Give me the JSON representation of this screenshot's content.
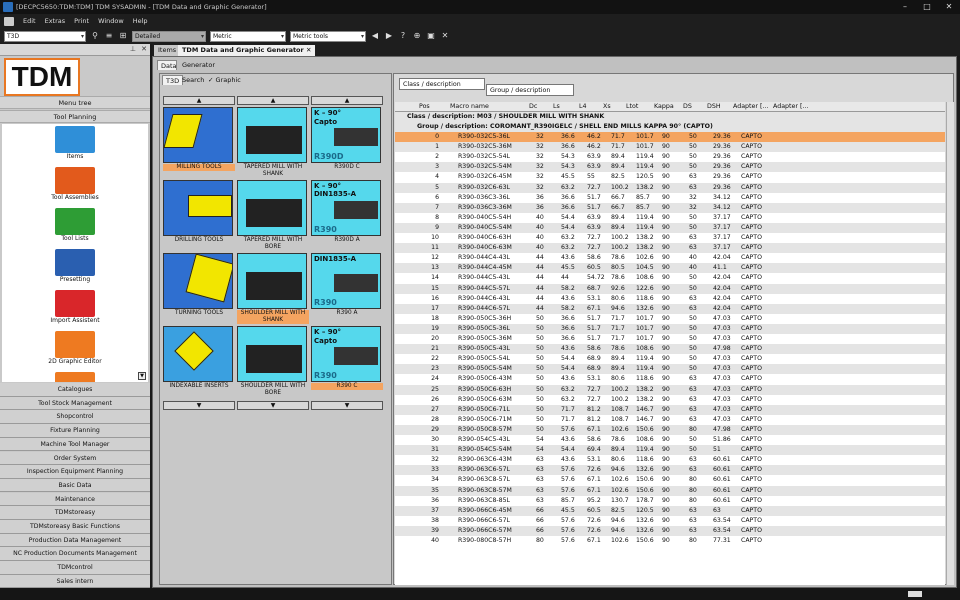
{
  "window": {
    "title": "[DECPC5650:TDM:TDM] TDM SYSADMIN - [TDM Data and Graphic Generator]"
  },
  "menu": [
    "Edit",
    "Extras",
    "Print",
    "Window",
    "Help"
  ],
  "toolbar": {
    "module_combo": "T3D",
    "view_combo": "Detailed",
    "unit_combo": "Metric",
    "unit_tools_combo": "Metric tools"
  },
  "left": {
    "logo": "TDM",
    "menu_tree": "Menu tree",
    "tool_planning": "Tool Planning",
    "items": [
      {
        "label": "Items",
        "color": "#2f8fd8"
      },
      {
        "label": "Tool Assemblies",
        "color": "#e25a1c"
      },
      {
        "label": "Tool Lists",
        "color": "#2e9d35"
      },
      {
        "label": "Presetting",
        "color": "#2a5fb0"
      },
      {
        "label": "Import Assistent",
        "color": "#d9262a"
      },
      {
        "label": "2D Graphic Editor",
        "color": "#ee7a21"
      },
      {
        "label": "",
        "color": "#ee7a21"
      }
    ],
    "nav": [
      "Catalogues",
      "Tool Stock Management",
      "Shopcontrol",
      "Fixture Planning",
      "Machine Tool Manager",
      "Order System",
      "Inspection Equipment Planning",
      "Basic Data",
      "Maintenance",
      "TDMstoreasy",
      "TDMstoreasy Basic Functions",
      "Production Data Management",
      "NC Production Documents Management",
      "TDMcontrol",
      "Sales intern"
    ]
  },
  "doctabs": [
    "Items",
    "TDM Data and Graphic Generator"
  ],
  "subtabs": [
    "Data",
    "Generator"
  ],
  "gallery": {
    "tabs": [
      "T3D",
      "Search",
      "Graphic"
    ],
    "graphic_checked": "✓",
    "up": "▲",
    "down": "▼",
    "cells": [
      {
        "label": "MILLING TOOLS",
        "selected": true,
        "kind": "mill"
      },
      {
        "label": "TAPERED MILL WITH SHANK",
        "selected": false,
        "kind": "taper"
      },
      {
        "label": "R390D C",
        "selected": false,
        "kind": "capto"
      },
      {
        "label": "DRILLING TOOLS",
        "selected": false,
        "kind": "drill"
      },
      {
        "label": "TAPERED MILL WITH BORE",
        "selected": false,
        "kind": "taper"
      },
      {
        "label": "R390D A",
        "selected": false,
        "kind": "din"
      },
      {
        "label": "TURNING TOOLS",
        "selected": false,
        "kind": "turn"
      },
      {
        "label": "SHOULDER MILL WITH SHANK",
        "selected": true,
        "kind": "taper"
      },
      {
        "label": "R390 A",
        "selected": false,
        "kind": "din2"
      },
      {
        "label": "INDEXABLE INSERTS",
        "selected": false,
        "kind": "insert"
      },
      {
        "label": "SHOULDER MILL WITH BORE",
        "selected": false,
        "kind": "taper"
      },
      {
        "label": "R390 C",
        "selected": true,
        "kind": "capto2"
      }
    ],
    "img_text": {
      "k90": "K – 90°",
      "capto": "Capto",
      "din": "DIN1835-A",
      "r390d": "R390D",
      "r390": "R390"
    }
  },
  "table": {
    "group_field1": "Class / description",
    "group_field2": "Group / description",
    "columns": [
      "Pos",
      "Macro name",
      "Dc",
      "Ls",
      "L4",
      "Xs",
      "Ltot",
      "Kappa",
      "DS",
      "DSH",
      "Adapter [...",
      "Adapter [..."
    ],
    "class_row": "Class / description: M03  /  SHOULDER MILL WITH SHANK",
    "group_row": "Group / description: COROMANT_R390IGELC  /  SHELL END MILLS KAPPA 90° (CAPTO)",
    "rows": [
      [
        "0",
        "R390-032C5-36L",
        "32",
        "36.6",
        "46.2",
        "71.7",
        "101.7",
        "90",
        "50",
        "29.36",
        "CAPTO"
      ],
      [
        "1",
        "R390-032C5-36M",
        "32",
        "36.6",
        "46.2",
        "71.7",
        "101.7",
        "90",
        "50",
        "29.36",
        "CAPTO"
      ],
      [
        "2",
        "R390-032C5-54L",
        "32",
        "54.3",
        "63.9",
        "89.4",
        "119.4",
        "90",
        "50",
        "29.36",
        "CAPTO"
      ],
      [
        "3",
        "R390-032C5-54M",
        "32",
        "54.3",
        "63.9",
        "89.4",
        "119.4",
        "90",
        "50",
        "29.36",
        "CAPTO"
      ],
      [
        "4",
        "R390-032C6-45M",
        "32",
        "45.5",
        "55",
        "82.5",
        "120.5",
        "90",
        "63",
        "29.36",
        "CAPTO"
      ],
      [
        "5",
        "R390-032C6-63L",
        "32",
        "63.2",
        "72.7",
        "100.2",
        "138.2",
        "90",
        "63",
        "29.36",
        "CAPTO"
      ],
      [
        "6",
        "R390-036C3-36L",
        "36",
        "36.6",
        "51.7",
        "66.7",
        "85.7",
        "90",
        "32",
        "34.12",
        "CAPTO"
      ],
      [
        "7",
        "R390-036C3-36M",
        "36",
        "36.6",
        "51.7",
        "66.7",
        "85.7",
        "90",
        "32",
        "34.12",
        "CAPTO"
      ],
      [
        "8",
        "R390-040C5-54H",
        "40",
        "54.4",
        "63.9",
        "89.4",
        "119.4",
        "90",
        "50",
        "37.17",
        "CAPTO"
      ],
      [
        "9",
        "R390-040C5-54M",
        "40",
        "54.4",
        "63.9",
        "89.4",
        "119.4",
        "90",
        "50",
        "37.17",
        "CAPTO"
      ],
      [
        "10",
        "R390-040C6-63H",
        "40",
        "63.2",
        "72.7",
        "100.2",
        "138.2",
        "90",
        "63",
        "37.17",
        "CAPTO"
      ],
      [
        "11",
        "R390-040C6-63M",
        "40",
        "63.2",
        "72.7",
        "100.2",
        "138.2",
        "90",
        "63",
        "37.17",
        "CAPTO"
      ],
      [
        "12",
        "R390-044C4-43L",
        "44",
        "43.6",
        "58.6",
        "78.6",
        "102.6",
        "90",
        "40",
        "42.04",
        "CAPTO"
      ],
      [
        "13",
        "R390-044C4-45M",
        "44",
        "45.5",
        "60.5",
        "80.5",
        "104.5",
        "90",
        "40",
        "41.1",
        "CAPTO"
      ],
      [
        "14",
        "R390-044C5-43L",
        "44",
        "44",
        "54.72",
        "78.6",
        "108.6",
        "90",
        "50",
        "42.04",
        "CAPTO"
      ],
      [
        "15",
        "R390-044C5-57L",
        "44",
        "58.2",
        "68.7",
        "92.6",
        "122.6",
        "90",
        "50",
        "42.04",
        "CAPTO"
      ],
      [
        "16",
        "R390-044C6-43L",
        "44",
        "43.6",
        "53.1",
        "80.6",
        "118.6",
        "90",
        "63",
        "42.04",
        "CAPTO"
      ],
      [
        "17",
        "R390-044C6-57L",
        "44",
        "58.2",
        "67.1",
        "94.6",
        "132.6",
        "90",
        "63",
        "42.04",
        "CAPTO"
      ],
      [
        "18",
        "R390-050C5-36H",
        "50",
        "36.6",
        "51.7",
        "71.7",
        "101.7",
        "90",
        "50",
        "47.03",
        "CAPTO"
      ],
      [
        "19",
        "R390-050C5-36L",
        "50",
        "36.6",
        "51.7",
        "71.7",
        "101.7",
        "90",
        "50",
        "47.03",
        "CAPTO"
      ],
      [
        "20",
        "R390-050C5-36M",
        "50",
        "36.6",
        "51.7",
        "71.7",
        "101.7",
        "90",
        "50",
        "47.03",
        "CAPTO"
      ],
      [
        "21",
        "R390-050C5-43L",
        "50",
        "43.6",
        "58.6",
        "78.6",
        "108.6",
        "90",
        "50",
        "47.98",
        "CAPTO"
      ],
      [
        "22",
        "R390-050C5-54L",
        "50",
        "54.4",
        "68.9",
        "89.4",
        "119.4",
        "90",
        "50",
        "47.03",
        "CAPTO"
      ],
      [
        "23",
        "R390-050C5-54M",
        "50",
        "54.4",
        "68.9",
        "89.4",
        "119.4",
        "90",
        "50",
        "47.03",
        "CAPTO"
      ],
      [
        "24",
        "R390-050C6-43M",
        "50",
        "43.6",
        "53.1",
        "80.6",
        "118.6",
        "90",
        "63",
        "47.03",
        "CAPTO"
      ],
      [
        "25",
        "R390-050C6-63H",
        "50",
        "63.2",
        "72.7",
        "100.2",
        "138.2",
        "90",
        "63",
        "47.03",
        "CAPTO"
      ],
      [
        "26",
        "R390-050C6-63M",
        "50",
        "63.2",
        "72.7",
        "100.2",
        "138.2",
        "90",
        "63",
        "47.03",
        "CAPTO"
      ],
      [
        "27",
        "R390-050C6-71L",
        "50",
        "71.7",
        "81.2",
        "108.7",
        "146.7",
        "90",
        "63",
        "47.03",
        "CAPTO"
      ],
      [
        "28",
        "R390-050C6-71M",
        "50",
        "71.7",
        "81.2",
        "108.7",
        "146.7",
        "90",
        "63",
        "47.03",
        "CAPTO"
      ],
      [
        "29",
        "R390-050C8-57M",
        "50",
        "57.6",
        "67.1",
        "102.6",
        "150.6",
        "90",
        "80",
        "47.98",
        "CAPTO"
      ],
      [
        "30",
        "R390-054C5-43L",
        "54",
        "43.6",
        "58.6",
        "78.6",
        "108.6",
        "90",
        "50",
        "51.86",
        "CAPTO"
      ],
      [
        "31",
        "R390-054C5-54M",
        "54",
        "54.4",
        "69.4",
        "89.4",
        "119.4",
        "90",
        "50",
        "51",
        "CAPTO"
      ],
      [
        "32",
        "R390-063C6-43M",
        "63",
        "43.6",
        "53.1",
        "80.6",
        "118.6",
        "90",
        "63",
        "60.61",
        "CAPTO"
      ],
      [
        "33",
        "R390-063C6-57L",
        "63",
        "57.6",
        "72.6",
        "94.6",
        "132.6",
        "90",
        "63",
        "60.61",
        "CAPTO"
      ],
      [
        "34",
        "R390-063C8-57L",
        "63",
        "57.6",
        "67.1",
        "102.6",
        "150.6",
        "90",
        "80",
        "60.61",
        "CAPTO"
      ],
      [
        "35",
        "R390-063C8-57M",
        "63",
        "57.6",
        "67.1",
        "102.6",
        "150.6",
        "90",
        "80",
        "60.61",
        "CAPTO"
      ],
      [
        "36",
        "R390-063C8-85L",
        "63",
        "85.7",
        "95.2",
        "130.7",
        "178.7",
        "90",
        "80",
        "60.61",
        "CAPTO"
      ],
      [
        "37",
        "R390-066C6-45M",
        "66",
        "45.5",
        "60.5",
        "82.5",
        "120.5",
        "90",
        "63",
        "63",
        "CAPTO"
      ],
      [
        "38",
        "R390-066C6-57L",
        "66",
        "57.6",
        "72.6",
        "94.6",
        "132.6",
        "90",
        "63",
        "63.54",
        "CAPTO"
      ],
      [
        "39",
        "R390-066C6-57M",
        "66",
        "57.6",
        "72.6",
        "94.6",
        "132.6",
        "90",
        "63",
        "63.54",
        "CAPTO"
      ],
      [
        "40",
        "R390-080C8-57H",
        "80",
        "57.6",
        "67.1",
        "102.6",
        "150.6",
        "90",
        "80",
        "77.31",
        "CAPTO"
      ]
    ]
  }
}
